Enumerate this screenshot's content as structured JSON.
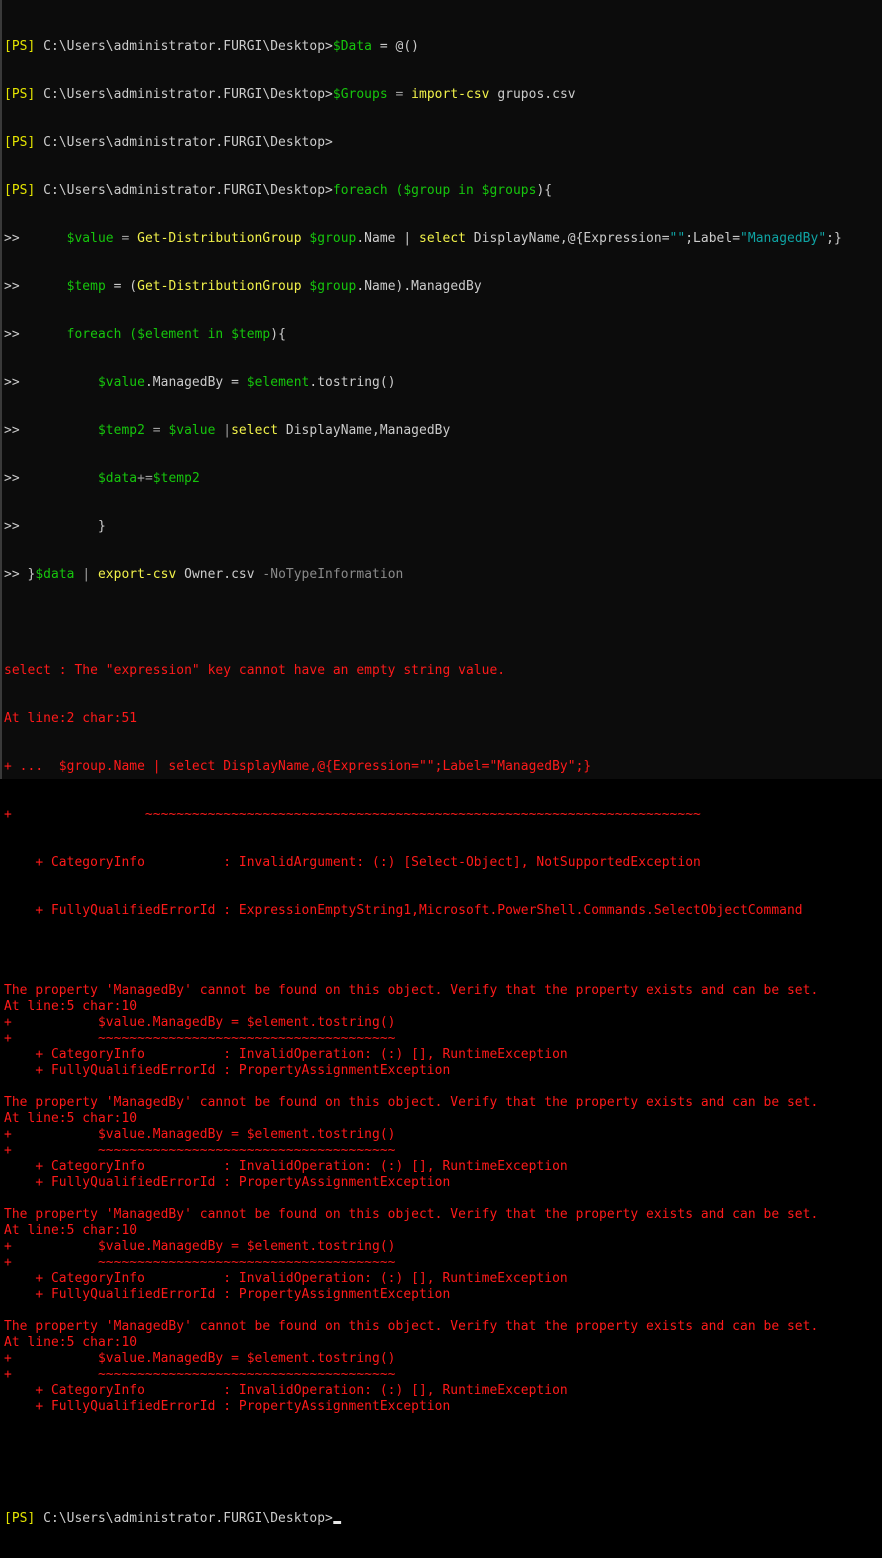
{
  "window": {
    "type": "PowerShell console"
  },
  "prompt": {
    "tag": "[PS]",
    "path": " C:\\Users\\administrator.FURGI\\Desktop>",
    "continuation": ">>"
  },
  "colors": {
    "background": "#0c0c0c",
    "prompt_tag": "#e5e500",
    "variable": "#16c60c",
    "command": "#f2f24a",
    "string": "#0fa4a4",
    "error": "#ff1a1a",
    "text": "#cccccc"
  },
  "commands": {
    "c1": {
      "var": "$Data",
      "rest": " = @()"
    },
    "c2": {
      "var": "$Groups",
      "eq": " = ",
      "cmd": "import-csv",
      "arg": " grupos.csv"
    },
    "c4": {
      "kw": "foreach (",
      "v1": "$group",
      "in": " in ",
      "v2": "$groups",
      "close": "){"
    },
    "l5": {
      "indent": "      ",
      "v": "$value",
      "eq": " = ",
      "cmd": "Get-DistributionGroup",
      "sp": " ",
      "v2": "$group",
      "p": ".Name | ",
      "sel": "select",
      "args": " DisplayName,@{Expression=",
      "q": "\"\"",
      "lbl": ";Label=",
      "str": "\"ManagedBy\"",
      "end": ";}"
    },
    "l6": {
      "indent": "      ",
      "v": "$temp",
      "eq": " = (",
      "cmd": "Get-DistributionGroup",
      "sp": " ",
      "v2": "$group",
      "end": ".Name).ManagedBy"
    },
    "l7": {
      "indent": "      ",
      "kw": "foreach (",
      "v1": "$element",
      "in": " in ",
      "v2": "$temp",
      "end": "){"
    },
    "l8": {
      "indent": "          ",
      "v": "$value",
      "p": ".ManagedBy = ",
      "v2": "$element",
      "end": ".tostring()"
    },
    "l9": {
      "indent": "          ",
      "v": "$temp2",
      "eq": " = ",
      "v2": "$value",
      "pipe": " |",
      "sel": "select",
      "end": " DisplayName,ManagedBy"
    },
    "l10": {
      "indent": "          ",
      "v": "$data",
      "op": "+=",
      "v2": "$temp2"
    },
    "l11": {
      "indent": "          ",
      "brace": "}"
    },
    "l12": {
      "pre": " }",
      "v": "$data",
      "pipe": " | ",
      "cmd": "export-csv",
      "arg": " Owner.csv ",
      "param": "-NoTypeInformation"
    }
  },
  "errors": {
    "first": [
      "select : The \"expression\" key cannot have an empty string value.",
      "At line:2 char:51",
      "+ ...  $group.Name | select DisplayName,@{Expression=\"\";Label=\"ManagedBy\";}",
      "+                 ~~~~~~~~~~~~~~~~~~~~~~~~~~~~~~~~~~~~~~~~~~~~~~~~~~~~~~~~~~~~~~~~~~~~~~~",
      "    + CategoryInfo          : InvalidArgument: (:) [Select-Object], NotSupportedException",
      "    + FullyQualifiedErrorId : ExpressionEmptyString1,Microsoft.PowerShell.Commands.SelectObjectCommand"
    ],
    "repeated": [
      "The property 'ManagedBy' cannot be found on this object. Verify that the property exists and can be set.",
      "At line:5 char:10",
      "+           $value.ManagedBy = $element.tostring()",
      "+           ~~~~~~~~~~~~~~~~~~~~~~~~~~~~~~~~~~~~~~",
      "    + CategoryInfo          : InvalidOperation: (:) [], RuntimeException",
      "    + FullyQualifiedErrorId : PropertyAssignmentException"
    ],
    "repeat_count": 4
  }
}
